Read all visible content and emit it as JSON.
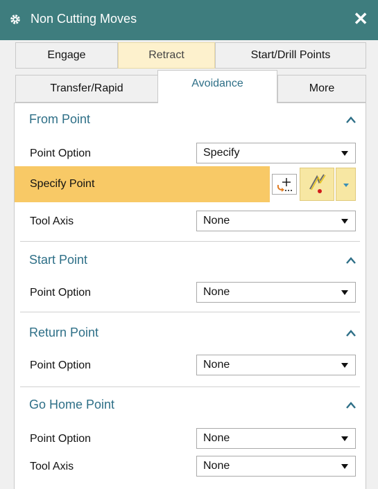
{
  "window": {
    "title": "Non Cutting Moves",
    "gear_icon": "gear-icon",
    "close_label": "✕",
    "title_bar_color": "#3e7d7e"
  },
  "tabs": {
    "row1": [
      {
        "label": "Engage"
      },
      {
        "label": "Retract"
      },
      {
        "label": "Start/Drill Points"
      }
    ],
    "row2": [
      {
        "label": "Transfer/Rapid"
      },
      {
        "label": "Avoidance"
      },
      {
        "label": "More"
      }
    ],
    "active": "Avoidance"
  },
  "sections": {
    "from_point": {
      "title": "From Point",
      "point_option_label": "Point Option",
      "point_option_value": "Specify",
      "specify_point_label": "Specify Point",
      "tool_axis_label": "Tool Axis",
      "tool_axis_value": "None"
    },
    "start_point": {
      "title": "Start Point",
      "point_option_label": "Point Option",
      "point_option_value": "None"
    },
    "return_point": {
      "title": "Return Point",
      "point_option_label": "Point Option",
      "point_option_value": "None"
    },
    "go_home_point": {
      "title": "Go Home Point",
      "point_option_label": "Point Option",
      "point_option_value": "None",
      "tool_axis_label": "Tool Axis",
      "tool_axis_value": "None"
    }
  },
  "colors": {
    "accent_text": "#2e6f87",
    "highlight_row": "#f8c966",
    "retract_tab": "#fdf1cd"
  }
}
